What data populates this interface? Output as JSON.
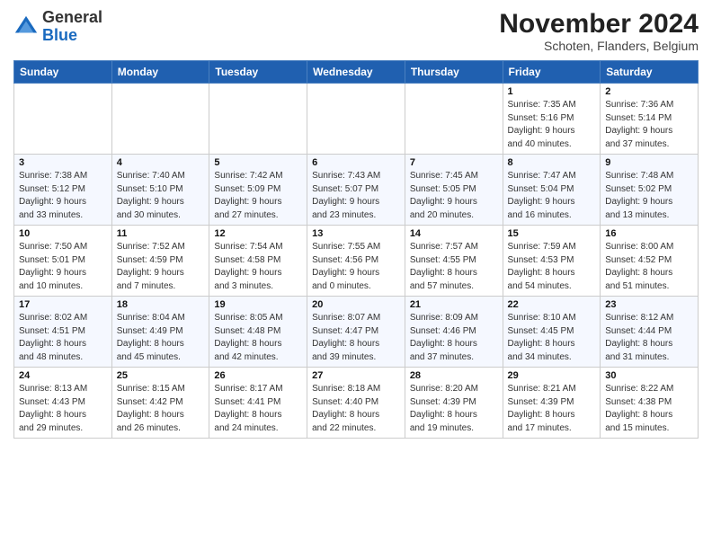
{
  "header": {
    "logo_general": "General",
    "logo_blue": "Blue",
    "month_year": "November 2024",
    "location": "Schoten, Flanders, Belgium"
  },
  "days_of_week": [
    "Sunday",
    "Monday",
    "Tuesday",
    "Wednesday",
    "Thursday",
    "Friday",
    "Saturday"
  ],
  "weeks": [
    [
      {
        "day": "",
        "info": ""
      },
      {
        "day": "",
        "info": ""
      },
      {
        "day": "",
        "info": ""
      },
      {
        "day": "",
        "info": ""
      },
      {
        "day": "",
        "info": ""
      },
      {
        "day": "1",
        "info": "Sunrise: 7:35 AM\nSunset: 5:16 PM\nDaylight: 9 hours\nand 40 minutes."
      },
      {
        "day": "2",
        "info": "Sunrise: 7:36 AM\nSunset: 5:14 PM\nDaylight: 9 hours\nand 37 minutes."
      }
    ],
    [
      {
        "day": "3",
        "info": "Sunrise: 7:38 AM\nSunset: 5:12 PM\nDaylight: 9 hours\nand 33 minutes."
      },
      {
        "day": "4",
        "info": "Sunrise: 7:40 AM\nSunset: 5:10 PM\nDaylight: 9 hours\nand 30 minutes."
      },
      {
        "day": "5",
        "info": "Sunrise: 7:42 AM\nSunset: 5:09 PM\nDaylight: 9 hours\nand 27 minutes."
      },
      {
        "day": "6",
        "info": "Sunrise: 7:43 AM\nSunset: 5:07 PM\nDaylight: 9 hours\nand 23 minutes."
      },
      {
        "day": "7",
        "info": "Sunrise: 7:45 AM\nSunset: 5:05 PM\nDaylight: 9 hours\nand 20 minutes."
      },
      {
        "day": "8",
        "info": "Sunrise: 7:47 AM\nSunset: 5:04 PM\nDaylight: 9 hours\nand 16 minutes."
      },
      {
        "day": "9",
        "info": "Sunrise: 7:48 AM\nSunset: 5:02 PM\nDaylight: 9 hours\nand 13 minutes."
      }
    ],
    [
      {
        "day": "10",
        "info": "Sunrise: 7:50 AM\nSunset: 5:01 PM\nDaylight: 9 hours\nand 10 minutes."
      },
      {
        "day": "11",
        "info": "Sunrise: 7:52 AM\nSunset: 4:59 PM\nDaylight: 9 hours\nand 7 minutes."
      },
      {
        "day": "12",
        "info": "Sunrise: 7:54 AM\nSunset: 4:58 PM\nDaylight: 9 hours\nand 3 minutes."
      },
      {
        "day": "13",
        "info": "Sunrise: 7:55 AM\nSunset: 4:56 PM\nDaylight: 9 hours\nand 0 minutes."
      },
      {
        "day": "14",
        "info": "Sunrise: 7:57 AM\nSunset: 4:55 PM\nDaylight: 8 hours\nand 57 minutes."
      },
      {
        "day": "15",
        "info": "Sunrise: 7:59 AM\nSunset: 4:53 PM\nDaylight: 8 hours\nand 54 minutes."
      },
      {
        "day": "16",
        "info": "Sunrise: 8:00 AM\nSunset: 4:52 PM\nDaylight: 8 hours\nand 51 minutes."
      }
    ],
    [
      {
        "day": "17",
        "info": "Sunrise: 8:02 AM\nSunset: 4:51 PM\nDaylight: 8 hours\nand 48 minutes."
      },
      {
        "day": "18",
        "info": "Sunrise: 8:04 AM\nSunset: 4:49 PM\nDaylight: 8 hours\nand 45 minutes."
      },
      {
        "day": "19",
        "info": "Sunrise: 8:05 AM\nSunset: 4:48 PM\nDaylight: 8 hours\nand 42 minutes."
      },
      {
        "day": "20",
        "info": "Sunrise: 8:07 AM\nSunset: 4:47 PM\nDaylight: 8 hours\nand 39 minutes."
      },
      {
        "day": "21",
        "info": "Sunrise: 8:09 AM\nSunset: 4:46 PM\nDaylight: 8 hours\nand 37 minutes."
      },
      {
        "day": "22",
        "info": "Sunrise: 8:10 AM\nSunset: 4:45 PM\nDaylight: 8 hours\nand 34 minutes."
      },
      {
        "day": "23",
        "info": "Sunrise: 8:12 AM\nSunset: 4:44 PM\nDaylight: 8 hours\nand 31 minutes."
      }
    ],
    [
      {
        "day": "24",
        "info": "Sunrise: 8:13 AM\nSunset: 4:43 PM\nDaylight: 8 hours\nand 29 minutes."
      },
      {
        "day": "25",
        "info": "Sunrise: 8:15 AM\nSunset: 4:42 PM\nDaylight: 8 hours\nand 26 minutes."
      },
      {
        "day": "26",
        "info": "Sunrise: 8:17 AM\nSunset: 4:41 PM\nDaylight: 8 hours\nand 24 minutes."
      },
      {
        "day": "27",
        "info": "Sunrise: 8:18 AM\nSunset: 4:40 PM\nDaylight: 8 hours\nand 22 minutes."
      },
      {
        "day": "28",
        "info": "Sunrise: 8:20 AM\nSunset: 4:39 PM\nDaylight: 8 hours\nand 19 minutes."
      },
      {
        "day": "29",
        "info": "Sunrise: 8:21 AM\nSunset: 4:39 PM\nDaylight: 8 hours\nand 17 minutes."
      },
      {
        "day": "30",
        "info": "Sunrise: 8:22 AM\nSunset: 4:38 PM\nDaylight: 8 hours\nand 15 minutes."
      }
    ]
  ]
}
